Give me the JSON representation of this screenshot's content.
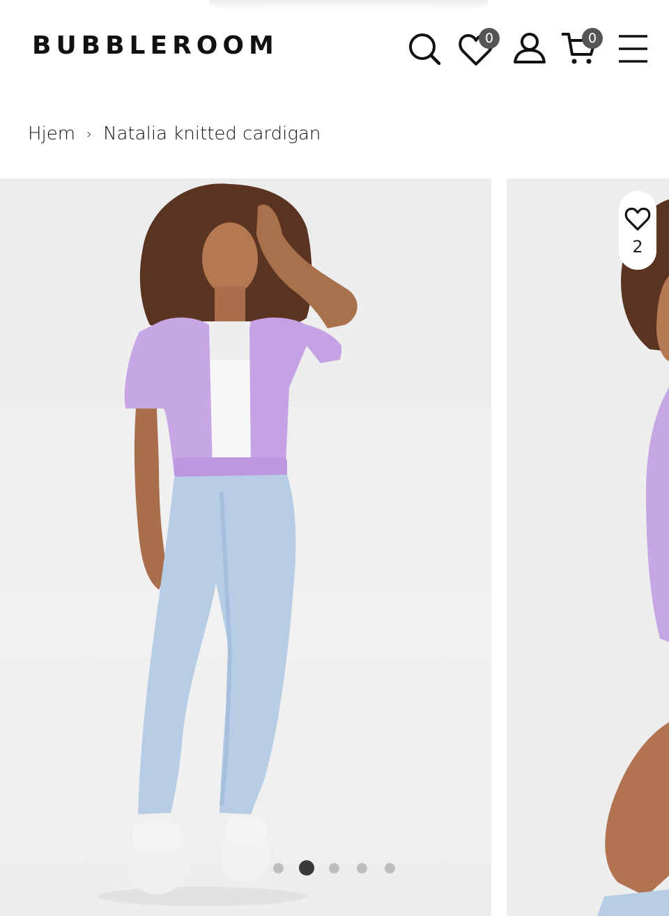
{
  "brand": {
    "logo_text": "BUBBLEROOM"
  },
  "header": {
    "icons": [
      "search-icon",
      "heart-icon",
      "user-icon",
      "cart-icon",
      "menu-icon"
    ],
    "wishlist_count": "0",
    "cart_count": "0"
  },
  "breadcrumb": {
    "home": "Hjem",
    "separator": "›",
    "current": "Natalia knitted cardigan"
  },
  "gallery": {
    "slide_count": 5,
    "active_slide_index": 1,
    "favorite_count": "2",
    "image_alt": "Natalia knitted cardigan"
  },
  "colors": {
    "badge": "#555555",
    "product_lilac": "#c7a6e6",
    "jeans": "#b7cde6",
    "image_background": "#ededed"
  }
}
